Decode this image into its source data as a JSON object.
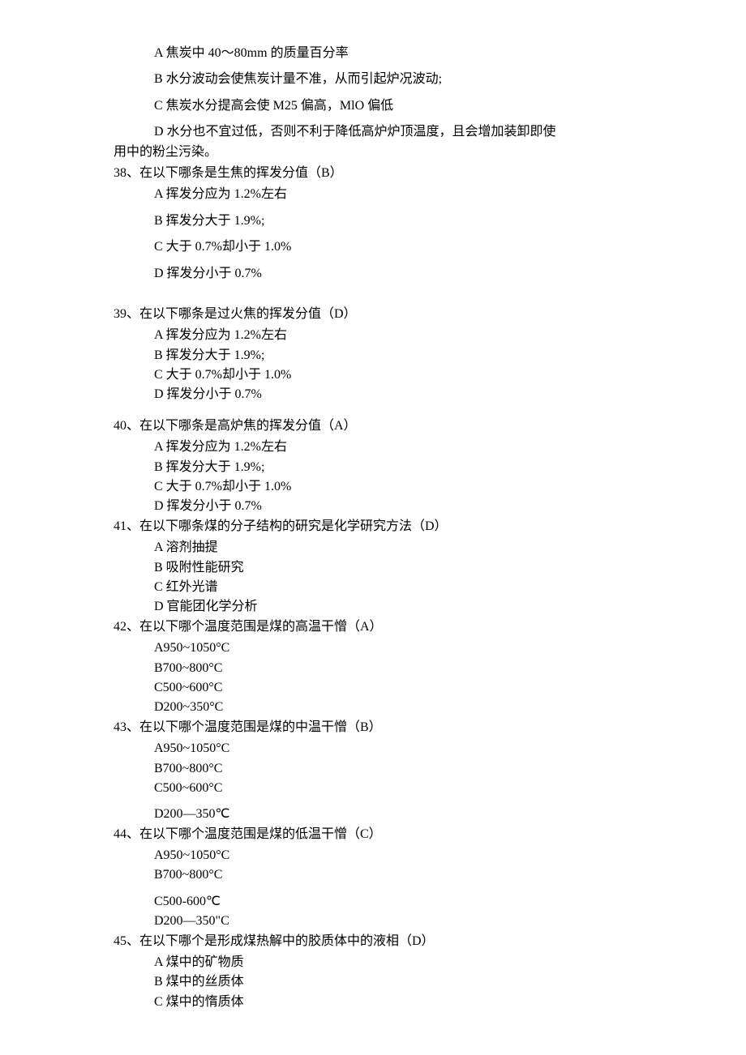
{
  "pre": {
    "a": "A 焦炭中 40～80mm 的质量百分率",
    "b": "B 水分波动会使焦炭计量不准，从而引起炉况波动;",
    "c": "C 焦炭水分提高会使 M25 偏高，MlO 偏低",
    "d1": "D 水分也不宜过低，否则不利于降低高炉炉顶温度，且会增加装卸即使",
    "d2": "用中的粉尘污染。"
  },
  "q38": {
    "q": "38、在以下哪条是生焦的挥发分值（B）",
    "a": "A 挥发分应为 1.2%左右",
    "b": "B 挥发分大于 1.9%;",
    "c": "C 大于 0.7%却小于 1.0%",
    "d": "D 挥发分小于 0.7%"
  },
  "q39": {
    "q": "39、在以下哪条是过火焦的挥发分值（D）",
    "a": "A 挥发分应为 1.2%左右",
    "b": "B 挥发分大于 1.9%;",
    "c": "C 大于 0.7%却小于 1.0%",
    "d": "D 挥发分小于 0.7%"
  },
  "q40": {
    "q": "40、在以下哪条是高炉焦的挥发分值（A）",
    "a": "A 挥发分应为 1.2%左右",
    "b": "B 挥发分大于 1.9%;",
    "c": "C 大于 0.7%却小于 1.0%",
    "d": "D 挥发分小于 0.7%"
  },
  "q41": {
    "q": "41、在以下哪条煤的分子结构的研究是化学研究方法（D）",
    "a": "A 溶剂抽提",
    "b": "B 吸附性能研究",
    "c": "C 红外光谱",
    "d": "D 官能团化学分析"
  },
  "q42": {
    "q": "42、在以下哪个温度范围是煤的高温干憎（A）",
    "a": "A950~1050°C",
    "b": "B700~800°C",
    "c": "C500~600°C",
    "d": "D200~350°C"
  },
  "q43": {
    "q": "43、在以下哪个温度范围是煤的中温干憎（B）",
    "a": "A950~1050°C",
    "b": "B700~800°C",
    "c": "C500~600°C",
    "d": "D200—350℃"
  },
  "q44": {
    "q": "44、在以下哪个温度范围是煤的低温干憎（C）",
    "a": "A950~1050°C",
    "b": "B700~800°C",
    "c": "C500-600℃",
    "d": "D200—350\"C"
  },
  "q45": {
    "q": "45、在以下哪个是形成煤热解中的胶质体中的液相（D）",
    "a": "A 煤中的矿物质",
    "b": "B 煤中的丝质体",
    "c": "C 煤中的惰质体"
  }
}
